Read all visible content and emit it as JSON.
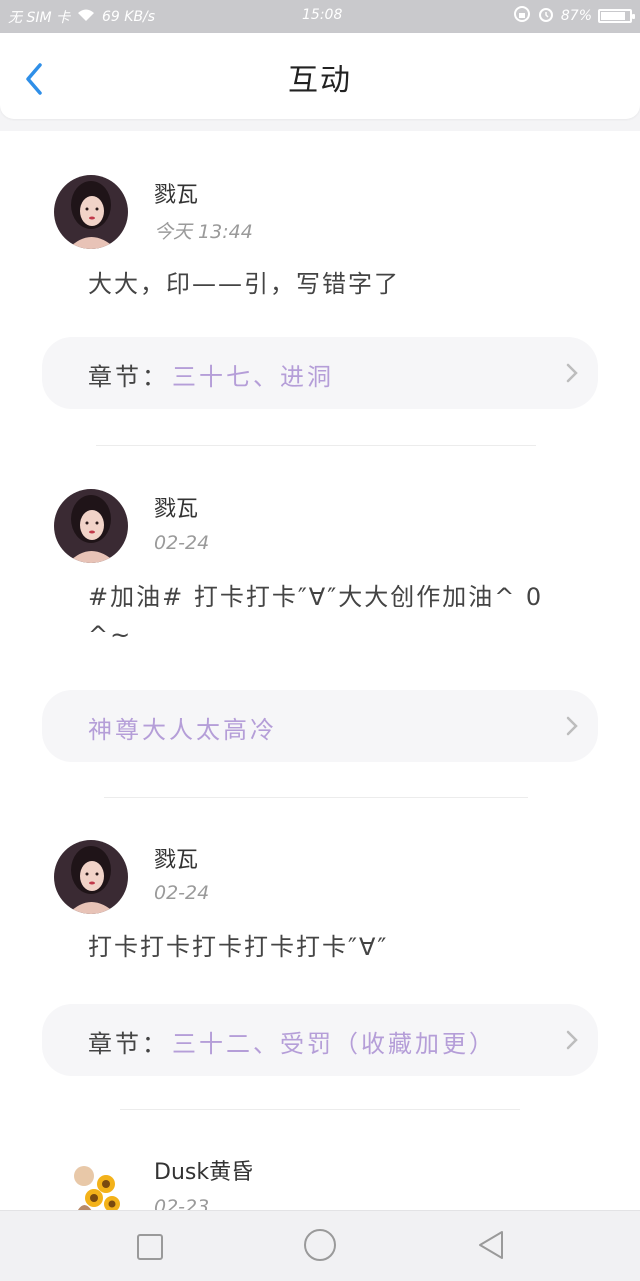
{
  "status_bar": {
    "carrier": "无 SIM 卡",
    "speed": "69 KB/s",
    "time": "15:08",
    "battery": "87%",
    "battery_level": 0.87
  },
  "header": {
    "title": "互动"
  },
  "posts": [
    {
      "name": "戮瓦",
      "date": "今天 13:44",
      "message": "大大，印——引，写错字了",
      "chip": {
        "label": "章节：",
        "value": "三十七、进洞"
      }
    },
    {
      "name": "戮瓦",
      "date": "02-24",
      "message": "#加油# 打卡打卡″∀″大大创作加油^ 0 ^~",
      "chip": {
        "label": "",
        "value": "神尊大人太高冷"
      }
    },
    {
      "name": "戮瓦",
      "date": "02-24",
      "message": "打卡打卡打卡打卡打卡″∀″",
      "chip": {
        "label": "章节：",
        "value": "三十二、受罚（收藏加更）"
      }
    },
    {
      "name": "Dusk黄昏",
      "date": "02-23"
    }
  ],
  "colors": {
    "accent": "#2f8fe8",
    "chip_text": "#b59ed8",
    "muted": "#9a9a9a"
  }
}
